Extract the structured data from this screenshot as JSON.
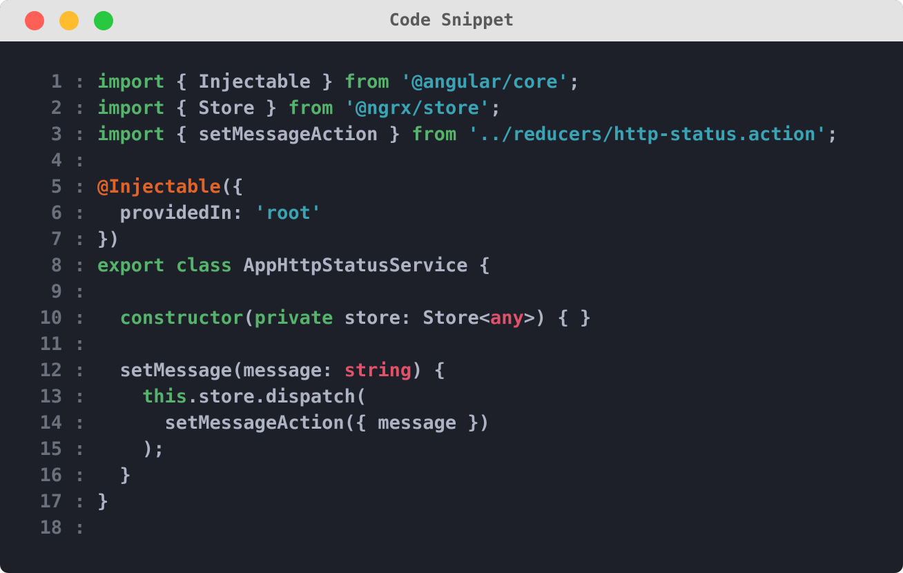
{
  "window": {
    "title": "Code Snippet"
  },
  "theme": {
    "background": "#1e2029",
    "titlebar": "#e3e3e3",
    "keyword": "#55b36b",
    "string": "#3aa3b4",
    "decorator": "#e0632a",
    "type": "#e0526a",
    "plain": "#aeb3c4",
    "line_number": "#6b707c"
  },
  "code": {
    "separator": ":",
    "lines": [
      {
        "n": "1",
        "tokens": [
          {
            "t": "import",
            "c": "kw"
          },
          {
            "t": " { Injectable } ",
            "c": "plain"
          },
          {
            "t": "from",
            "c": "kw"
          },
          {
            "t": " ",
            "c": "plain"
          },
          {
            "t": "'@angular/core'",
            "c": "str"
          },
          {
            "t": ";",
            "c": "plain"
          }
        ]
      },
      {
        "n": "2",
        "tokens": [
          {
            "t": "import",
            "c": "kw"
          },
          {
            "t": " { Store } ",
            "c": "plain"
          },
          {
            "t": "from",
            "c": "kw"
          },
          {
            "t": " ",
            "c": "plain"
          },
          {
            "t": "'@ngrx/store'",
            "c": "str"
          },
          {
            "t": ";",
            "c": "plain"
          }
        ]
      },
      {
        "n": "3",
        "tokens": [
          {
            "t": "import",
            "c": "kw"
          },
          {
            "t": " { setMessageAction } ",
            "c": "plain"
          },
          {
            "t": "from",
            "c": "kw"
          },
          {
            "t": " ",
            "c": "plain"
          },
          {
            "t": "'../reducers/http-status.action'",
            "c": "str"
          },
          {
            "t": ";",
            "c": "plain"
          }
        ]
      },
      {
        "n": "4",
        "tokens": []
      },
      {
        "n": "5",
        "tokens": [
          {
            "t": "@Injectable",
            "c": "dec"
          },
          {
            "t": "({",
            "c": "plain"
          }
        ]
      },
      {
        "n": "6",
        "tokens": [
          {
            "t": "  providedIn: ",
            "c": "plain"
          },
          {
            "t": "'root'",
            "c": "str"
          }
        ]
      },
      {
        "n": "7",
        "tokens": [
          {
            "t": "})",
            "c": "plain"
          }
        ]
      },
      {
        "n": "8",
        "tokens": [
          {
            "t": "export",
            "c": "kw"
          },
          {
            "t": " ",
            "c": "plain"
          },
          {
            "t": "class",
            "c": "kw"
          },
          {
            "t": " AppHttpStatusService {",
            "c": "plain"
          }
        ]
      },
      {
        "n": "9",
        "tokens": []
      },
      {
        "n": "10",
        "tokens": [
          {
            "t": "  ",
            "c": "plain"
          },
          {
            "t": "constructor",
            "c": "kw"
          },
          {
            "t": "(",
            "c": "plain"
          },
          {
            "t": "private",
            "c": "kw"
          },
          {
            "t": " store: Store<",
            "c": "plain"
          },
          {
            "t": "any",
            "c": "typ"
          },
          {
            "t": ">) { }",
            "c": "plain"
          }
        ]
      },
      {
        "n": "11",
        "tokens": []
      },
      {
        "n": "12",
        "tokens": [
          {
            "t": "  setMessage(message: ",
            "c": "plain"
          },
          {
            "t": "string",
            "c": "typ"
          },
          {
            "t": ") {",
            "c": "plain"
          }
        ]
      },
      {
        "n": "13",
        "tokens": [
          {
            "t": "    ",
            "c": "plain"
          },
          {
            "t": "this",
            "c": "kw"
          },
          {
            "t": ".store.dispatch(",
            "c": "plain"
          }
        ]
      },
      {
        "n": "14",
        "tokens": [
          {
            "t": "      setMessageAction({ message })",
            "c": "plain"
          }
        ]
      },
      {
        "n": "15",
        "tokens": [
          {
            "t": "    );",
            "c": "plain"
          }
        ]
      },
      {
        "n": "16",
        "tokens": [
          {
            "t": "  }",
            "c": "plain"
          }
        ]
      },
      {
        "n": "17",
        "tokens": [
          {
            "t": "}",
            "c": "plain"
          }
        ]
      },
      {
        "n": "18",
        "tokens": []
      }
    ]
  }
}
